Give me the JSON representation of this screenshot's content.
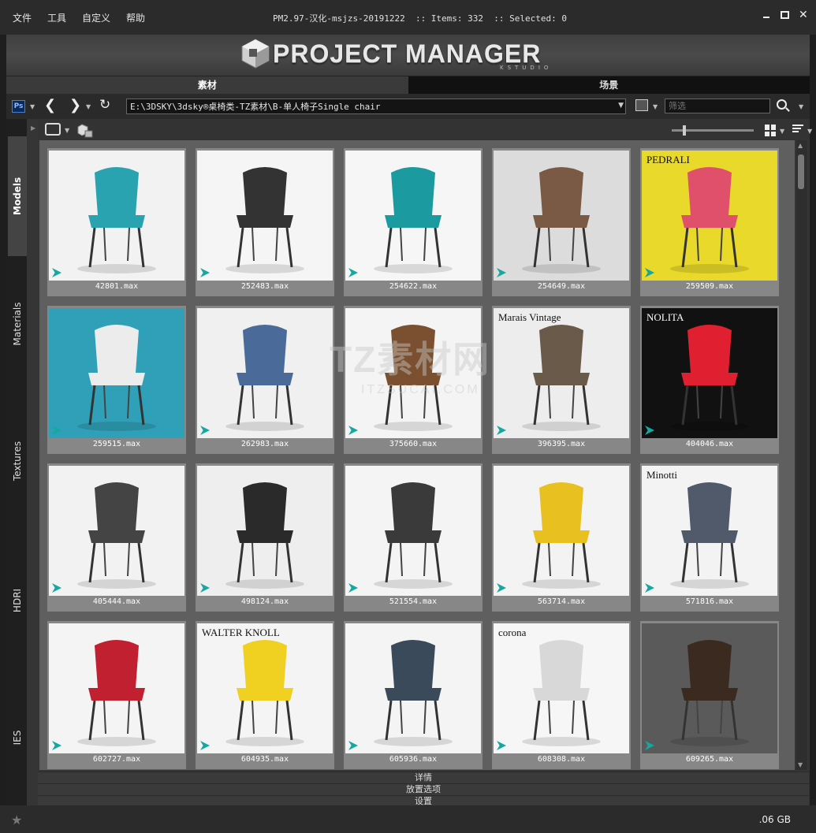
{
  "menu": [
    "文件",
    "工具",
    "自定义",
    "帮助"
  ],
  "window_title": "PM2.97-汉化-msjzs-20191222  :: Items: 332  :: Selected: 0",
  "logo": {
    "text": "PROJECT MANAGER",
    "sub": "KSTUDIO"
  },
  "main_tabs": [
    {
      "label": "素材",
      "active": true
    },
    {
      "label": "场景",
      "active": false
    }
  ],
  "nav": {
    "ps_label": "Ps",
    "path": "E:\\3DSKY\\3dsky®桌椅类-TZ素材\\B-单人椅子Single chair",
    "filter_placeholder": "筛选"
  },
  "side_tabs": [
    {
      "label": "Models",
      "active": true
    },
    {
      "label": "Materials",
      "active": false
    },
    {
      "label": "Textures",
      "active": false
    },
    {
      "label": "HDRI",
      "active": false
    },
    {
      "label": "IES",
      "active": false
    }
  ],
  "items": [
    {
      "name": "42801.max",
      "bg": "#f2f2f2",
      "accent": "#2aa3b0",
      "cap": ""
    },
    {
      "name": "252483.max",
      "bg": "#f5f5f5",
      "accent": "#333333",
      "cap": ""
    },
    {
      "name": "254622.max",
      "bg": "#f6f6f6",
      "accent": "#1b9aa0",
      "cap": ""
    },
    {
      "name": "254649.max",
      "bg": "#dcdcdc",
      "accent": "#7a5a45",
      "cap": ""
    },
    {
      "name": "259509.max",
      "bg": "#e8d92a",
      "accent": "#e0506a",
      "cap": "PEDRALI"
    },
    {
      "name": "259515.max",
      "bg": "#2fa0b8",
      "accent": "#ececec",
      "cap": ""
    },
    {
      "name": "262983.max",
      "bg": "#f0f0f0",
      "accent": "#4a6a9a",
      "cap": ""
    },
    {
      "name": "375660.max",
      "bg": "#f4f4f4",
      "accent": "#7a5030",
      "cap": ""
    },
    {
      "name": "396395.max",
      "bg": "#ededed",
      "accent": "#6a5a4a",
      "cap": "Marais Vintage"
    },
    {
      "name": "404046.max",
      "bg": "#111111",
      "accent": "#e02030",
      "cap": "NOLITA"
    },
    {
      "name": "405444.max",
      "bg": "#f2f2f2",
      "accent": "#444444",
      "cap": ""
    },
    {
      "name": "498124.max",
      "bg": "#eeeeee",
      "accent": "#2a2a2a",
      "cap": ""
    },
    {
      "name": "521554.max",
      "bg": "#f4f4f4",
      "accent": "#3a3a3a",
      "cap": ""
    },
    {
      "name": "563714.max",
      "bg": "#f3f3f3",
      "accent": "#e8c020",
      "cap": ""
    },
    {
      "name": "571816.max",
      "bg": "#f3f3f3",
      "accent": "#505a6a",
      "cap": "Minotti"
    },
    {
      "name": "602727.max",
      "bg": "#f4f4f4",
      "accent": "#c02030",
      "cap": ""
    },
    {
      "name": "604935.max",
      "bg": "#f4f4f4",
      "accent": "#f0d020",
      "cap": "WALTER KNOLL"
    },
    {
      "name": "605936.max",
      "bg": "#f4f4f4",
      "accent": "#3a4a5a",
      "cap": ""
    },
    {
      "name": "608308.max",
      "bg": "#f6f6f6",
      "accent": "#d8d8d8",
      "cap": "corona"
    },
    {
      "name": "609265.max",
      "bg": "#5a5a5a",
      "accent": "#3a2a20",
      "cap": ""
    }
  ],
  "watermark": {
    "main": "TZ素材网",
    "sub": "ITZSUCAI.COM"
  },
  "bottom_sections": [
    "详情",
    "放置选项",
    "设置"
  ],
  "status": {
    "disk": ".06 GB"
  }
}
